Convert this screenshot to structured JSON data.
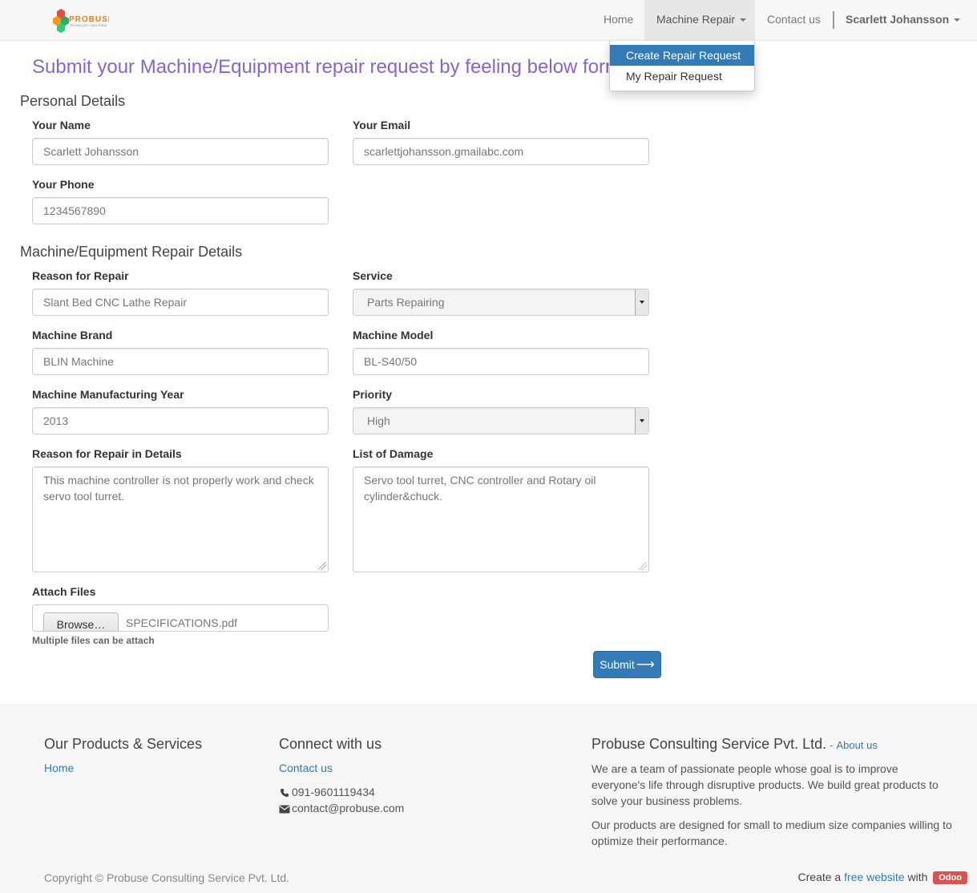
{
  "nav": {
    "home": "Home",
    "machine_repair": "Machine Repair",
    "contact": "Contact us",
    "user": "Scarlett Johansson"
  },
  "logo": {
    "text": "PROBUSE",
    "tagline": "TECHNOLOGY. SOLUTIONS"
  },
  "dropdown": {
    "items": [
      {
        "label": "Create Repair Request",
        "active": true
      },
      {
        "label": "My Repair Request",
        "active": false
      }
    ]
  },
  "page": {
    "title": "Submit your Machine/Equipment repair request by feeling below form",
    "personal_section": "Personal Details",
    "repair_section": "Machine/Equipment Repair Details"
  },
  "form": {
    "name_label": "Your Name",
    "name_value": "Scarlett Johansson",
    "email_label": "Your Email",
    "email_value": "scarlettjohansson.gmailabc.com",
    "phone_label": "Your Phone",
    "phone_value": "1234567890",
    "reason_label": "Reason for Repair",
    "reason_value": "Slant Bed CNC Lathe Repair",
    "service_label": "Service",
    "service_value": "Parts Repairing",
    "brand_label": "Machine Brand",
    "brand_value": "BLIN Machine",
    "model_label": "Machine Model",
    "model_value": "BL-S40/50",
    "year_label": "Machine Manufacturing Year",
    "year_value": "2013",
    "priority_label": "Priority",
    "priority_value": "High",
    "details_label": "Reason for Repair in Details",
    "details_value": "This machine controller is not properly work and check servo tool turret.",
    "damage_label": "List of Damage",
    "damage_value": "Servo tool turret, CNC controller and Rotary oil cylinder&chuck.",
    "attach_label": "Attach Files",
    "browse_label": "Browse…",
    "file_name": "SPECIFICATIONS.pdf",
    "attach_help": "Multiple files can be attach",
    "submit_label": "Submit"
  },
  "footer": {
    "products_title": "Our Products & Services",
    "products_home": "Home",
    "connect_title": "Connect with us",
    "connect_contact": "Contact us",
    "phone": "091-9601119434",
    "email": "contact@probuse.com",
    "company_title": "Probuse Consulting Service Pvt. Ltd.",
    "about_dash": "-",
    "about_link": "About us",
    "para1": "We are a team of passionate people whose goal is to improve everyone's life through disruptive products. We build great products to solve your business problems.",
    "para2": "Our products are designed for small to medium size companies willing to optimize their performance.",
    "copyright": "Copyright © Probuse Consulting Service Pvt. Ltd.",
    "create_prefix": "Create a",
    "create_link": "free website",
    "create_with": "with",
    "odoo": "Odoo"
  },
  "colors": {
    "accent_blue": "#337ab7",
    "title_purple": "#8a63d2",
    "odoo_red": "#d9534f"
  }
}
